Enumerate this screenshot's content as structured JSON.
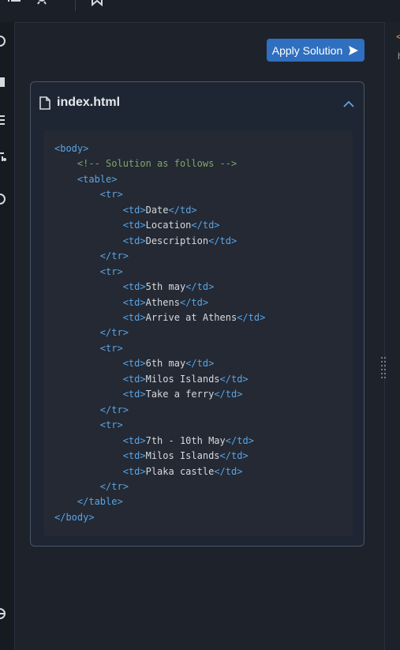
{
  "topbar": {
    "icons": [
      "list-icon",
      "sun-icon",
      "bookmark-icon"
    ]
  },
  "leftrail": {
    "icons": [
      "circle-icon",
      "square-icon",
      "list-icon",
      "branch-icon",
      "circle-icon",
      "globe-icon"
    ]
  },
  "toolbar": {
    "apply_label": "Apply Solution",
    "apply_color": "#2f6fbf"
  },
  "file": {
    "name": "index.html",
    "collapse_icon": "chevron-up-icon"
  },
  "code": {
    "lines": [
      {
        "indent": 0,
        "open": "<body>",
        "text": "",
        "close": ""
      },
      {
        "indent": 1,
        "comment": "<!-- Solution as follows -->"
      },
      {
        "indent": 1,
        "open": "<table>",
        "text": "",
        "close": ""
      },
      {
        "indent": 2,
        "open": "<tr>",
        "text": "",
        "close": ""
      },
      {
        "indent": 3,
        "open": "<td>",
        "text": "Date",
        "close": "</td>"
      },
      {
        "indent": 3,
        "open": "<td>",
        "text": "Location",
        "close": "</td>"
      },
      {
        "indent": 3,
        "open": "<td>",
        "text": "Description",
        "close": "</td>"
      },
      {
        "indent": 2,
        "open": "</tr>",
        "text": "",
        "close": ""
      },
      {
        "indent": 2,
        "open": "<tr>",
        "text": "",
        "close": ""
      },
      {
        "indent": 3,
        "open": "<td>",
        "text": "5th may",
        "close": "</td>"
      },
      {
        "indent": 3,
        "open": "<td>",
        "text": "Athens",
        "close": "</td>"
      },
      {
        "indent": 3,
        "open": "<td>",
        "text": "Arrive at Athens",
        "close": "</td>"
      },
      {
        "indent": 2,
        "open": "</tr>",
        "text": "",
        "close": ""
      },
      {
        "indent": 2,
        "open": "<tr>",
        "text": "",
        "close": ""
      },
      {
        "indent": 3,
        "open": "<td>",
        "text": "6th may",
        "close": "</td>"
      },
      {
        "indent": 3,
        "open": "<td>",
        "text": "Milos Islands",
        "close": "</td>"
      },
      {
        "indent": 3,
        "open": "<td>",
        "text": "Take a ferry",
        "close": "</td>"
      },
      {
        "indent": 2,
        "open": "</tr>",
        "text": "",
        "close": ""
      },
      {
        "indent": 2,
        "open": "<tr>",
        "text": "",
        "close": ""
      },
      {
        "indent": 3,
        "open": "<td>",
        "text": "7th - 10th May",
        "close": "</td>"
      },
      {
        "indent": 3,
        "open": "<td>",
        "text": "Milos Islands",
        "close": "</td>"
      },
      {
        "indent": 3,
        "open": "<td>",
        "text": "Plaka castle",
        "close": "</td>"
      },
      {
        "indent": 2,
        "open": "</tr>",
        "text": "",
        "close": ""
      },
      {
        "indent": 1,
        "open": "</table>",
        "text": "",
        "close": ""
      },
      {
        "indent": 0,
        "open": "</body>",
        "text": "",
        "close": ""
      }
    ]
  },
  "rightpane": {
    "preview_char": "h"
  },
  "colors": {
    "tag": "#5aa4e6",
    "comment": "#7fa66b",
    "text": "#d6d9de",
    "background": "#1e222b"
  }
}
